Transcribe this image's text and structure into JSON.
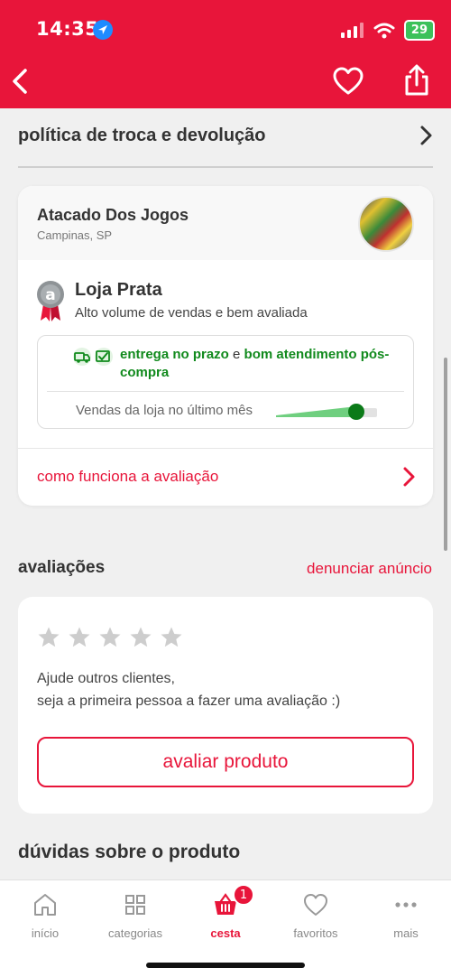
{
  "status_bar": {
    "time": "14:35",
    "battery": "29"
  },
  "policy": {
    "label": "política de troca e devolução"
  },
  "store": {
    "name": "Atacado Dos Jogos",
    "location": "Campinas, SP",
    "tier_title": "Loja Prata",
    "tier_description": "Alto volume de vendas e bem avaliada",
    "metric": {
      "part1": "entrega no prazo",
      "connector": " e ",
      "part2": "bom atendimento pós-compra"
    },
    "sales_label": "Vendas da loja no último mês",
    "sales_level": 0.78,
    "how_label": "como funciona a avaliação"
  },
  "reviews": {
    "title": "avaliações",
    "report_label": "denunciar anúncio",
    "rating_stars": 5,
    "help_line1": "Ajude outros clientes,",
    "help_line2": "seja a primeira pessoa a fazer uma avaliação :)",
    "button_label": "avaliar produto"
  },
  "questions": {
    "title": "dúvidas sobre o produto"
  },
  "tabbar": {
    "home": "início",
    "categories": "categorias",
    "cart": "cesta",
    "cart_count": "1",
    "favorites": "favoritos",
    "more": "mais"
  },
  "colors": {
    "brand": "#e8153a",
    "success": "#118a1d"
  }
}
